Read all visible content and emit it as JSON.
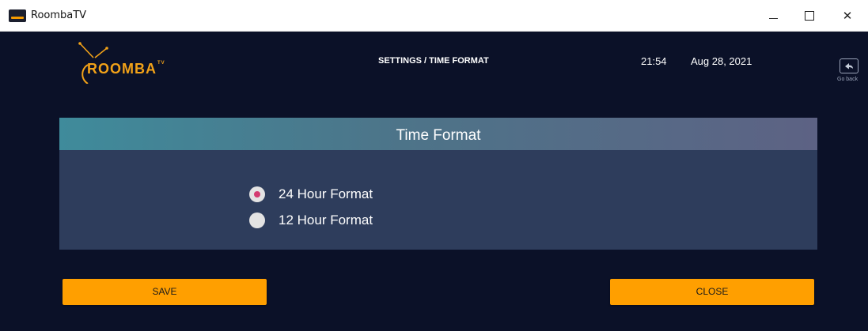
{
  "window": {
    "title": "RoombaTV",
    "controls": {
      "minimize": "minimize",
      "maximize": "maximize",
      "close": "✕"
    }
  },
  "header": {
    "logo_text": "ROOMBA",
    "logo_tm": "TV",
    "page_title": "SETTINGS / TIME FORMAT",
    "time": "21:54",
    "date": "Aug 28, 2021",
    "go_back_label": "Go back"
  },
  "panel": {
    "title": "Time Format",
    "options": [
      {
        "label": "24 Hour Format",
        "selected": true
      },
      {
        "label": "12 Hour Format",
        "selected": false
      }
    ]
  },
  "buttons": {
    "save": "SAVE",
    "close": "CLOSE"
  },
  "colors": {
    "background": "#0b1128",
    "panel": "#2e3d5c",
    "accent": "#ff9f00",
    "logo": "#f2a218",
    "radio_selected": "#d43b71",
    "header_gradient_start": "#3f8b9b",
    "header_gradient_end": "#5d6284"
  },
  "icons": {
    "app": "roomba-tv-app-icon",
    "go_back": "return-arrow-icon",
    "logo_antenna": "tv-antenna-icon"
  }
}
